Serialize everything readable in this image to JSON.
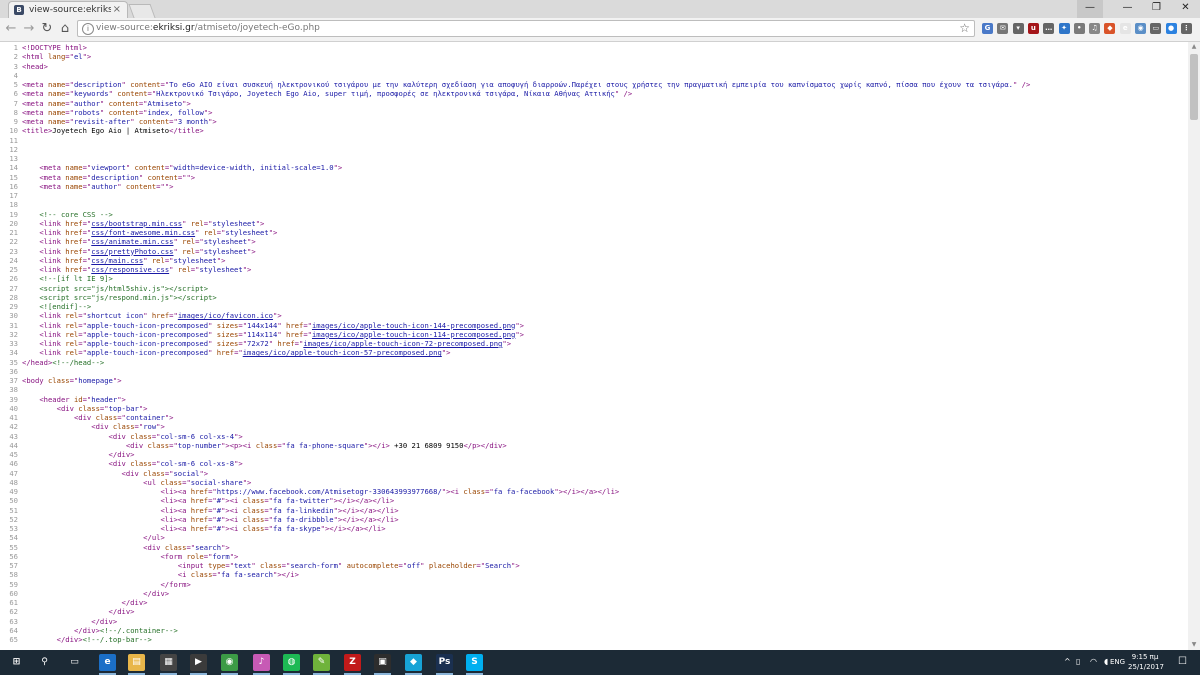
{
  "tab": {
    "favicon_letter": "B",
    "title": "view-source:ekriksi.gr/atr",
    "close": "×"
  },
  "window": {
    "user": "—",
    "minimize": "—",
    "maximize": "❐",
    "close": "✕"
  },
  "nav": {
    "back": "←",
    "forward": "→",
    "reload": "↻",
    "home": "⌂"
  },
  "omnibox": {
    "info": "i",
    "prefix": "view-source:",
    "host": "ekriksi.gr",
    "path": "/atmiseto/joyetech-eGo.php",
    "star": "☆"
  },
  "extensions": [
    {
      "name": "translate-icon",
      "color": "#4a79c8",
      "glyph": "G"
    },
    {
      "name": "mail-icon",
      "color": "#777777",
      "glyph": "✉"
    },
    {
      "name": "pocket-icon",
      "color": "#666666",
      "glyph": "▾"
    },
    {
      "name": "ublock-icon",
      "color": "#a5161a",
      "glyph": "u"
    },
    {
      "name": "lastpass-icon",
      "color": "#666666",
      "glyph": "…"
    },
    {
      "name": "puzzle-icon",
      "color": "#2f76c9",
      "glyph": "✦"
    },
    {
      "name": "ext-badge-icon",
      "color": "#7a7a7a",
      "glyph": "•"
    },
    {
      "name": "hangouts-icon",
      "color": "#888888",
      "glyph": "♫"
    },
    {
      "name": "fire-icon",
      "color": "#d9542a",
      "glyph": "◆"
    },
    {
      "name": "ebay-icon",
      "color": "#e5e5e5",
      "glyph": "e"
    },
    {
      "name": "rss-icon",
      "color": "#5b8fc7",
      "glyph": "◉"
    },
    {
      "name": "cast-icon",
      "color": "#666666",
      "glyph": "▭"
    },
    {
      "name": "chrome-apps-icon",
      "color": "#2c82e0",
      "glyph": "●"
    },
    {
      "name": "menu-icon",
      "color": "#666666",
      "glyph": "⋮"
    }
  ],
  "source_lines": [
    {
      "n": "1",
      "html": "<span class='tag'>&lt;!DOCTYPE html&gt;</span>"
    },
    {
      "n": "2",
      "html": "<span class='tag'>&lt;html <span class='attr'>lang</span>=\"<span class='val'>el</span>\"&gt;</span>"
    },
    {
      "n": "3",
      "html": "<span class='tag'>&lt;head&gt;</span>"
    },
    {
      "n": "4",
      "html": ""
    },
    {
      "n": "5",
      "html": "<span class='tag'>&lt;meta <span class='attr'>name</span>=\"<span class='val'>description</span>\" <span class='attr'>content</span>=\"<span class='val'>Το eGo AIO είναι συσκευή ηλεκτρονικού τσιγάρου με την καλύτερη σχεδίαση για αποφυγή διαρροών.Παρέχει στους χρήστες την πραγματική εμπειρία του καπνίσματος χωρίς καπνό, πίσσα που έχουν τα τσιγάρα.</span>\" /&gt;</span>"
    },
    {
      "n": "6",
      "html": "<span class='tag'>&lt;meta <span class='attr'>name</span>=\"<span class='val'>keywords</span>\" <span class='attr'>content</span>=\"<span class='val'>Ηλεκτρονικό Τσιγάρο, Joyetech Ego Aio, super τιμή, προσφορές σε ηλεκτρονικά τσιγάρα, Νίκαια Αθήνας Αττικής</span>\" /&gt;</span>"
    },
    {
      "n": "7",
      "html": "<span class='tag'>&lt;meta <span class='attr'>name</span>=\"<span class='val'>author</span>\" <span class='attr'>content</span>=\"<span class='val'>Atmiseto</span>\"&gt;</span>"
    },
    {
      "n": "8",
      "html": "<span class='tag'>&lt;meta <span class='attr'>name</span>=\"<span class='val'>robots</span>\" <span class='attr'>content</span>=\"<span class='val'>index, follow</span>\"&gt;</span>"
    },
    {
      "n": "9",
      "html": "<span class='tag'>&lt;meta <span class='attr'>name</span>=\"<span class='val'>revisit-after</span>\" <span class='attr'>content</span>=\"<span class='val'>3 month</span>\"&gt;</span>"
    },
    {
      "n": "10",
      "html": "<span class='tag'>&lt;title&gt;</span>Joyetech Ego Aio | Atmiseto<span class='tag'>&lt;/title&gt;</span>"
    },
    {
      "n": "11",
      "html": ""
    },
    {
      "n": "12",
      "html": ""
    },
    {
      "n": "13",
      "html": ""
    },
    {
      "n": "14",
      "html": "    <span class='tag'>&lt;meta <span class='attr'>name</span>=\"<span class='val'>viewport</span>\" <span class='attr'>content</span>=\"<span class='val'>width=device-width, initial-scale=1.0</span>\"&gt;</span>"
    },
    {
      "n": "15",
      "html": "    <span class='tag'>&lt;meta <span class='attr'>name</span>=\"<span class='val'>description</span>\" <span class='attr'>content</span>=\"\"&gt;</span>"
    },
    {
      "n": "16",
      "html": "    <span class='tag'>&lt;meta <span class='attr'>name</span>=\"<span class='val'>author</span>\" <span class='attr'>content</span>=\"\"&gt;</span>"
    },
    {
      "n": "17",
      "html": ""
    },
    {
      "n": "18",
      "html": ""
    },
    {
      "n": "19",
      "html": "    <span class='cmt'>&lt;!-- core CSS --&gt;</span>"
    },
    {
      "n": "20",
      "html": "    <span class='tag'>&lt;link <span class='attr'>href</span>=\"<span class='link'>css/bootstrap.min.css</span>\" <span class='attr'>rel</span>=\"<span class='val'>stylesheet</span>\"&gt;</span>"
    },
    {
      "n": "21",
      "html": "    <span class='tag'>&lt;link <span class='attr'>href</span>=\"<span class='link'>css/font-awesome.min.css</span>\" <span class='attr'>rel</span>=\"<span class='val'>stylesheet</span>\"&gt;</span>"
    },
    {
      "n": "22",
      "html": "    <span class='tag'>&lt;link <span class='attr'>href</span>=\"<span class='link'>css/animate.min.css</span>\" <span class='attr'>rel</span>=\"<span class='val'>stylesheet</span>\"&gt;</span>"
    },
    {
      "n": "23",
      "html": "    <span class='tag'>&lt;link <span class='attr'>href</span>=\"<span class='link'>css/prettyPhoto.css</span>\" <span class='attr'>rel</span>=\"<span class='val'>stylesheet</span>\"&gt;</span>"
    },
    {
      "n": "24",
      "html": "    <span class='tag'>&lt;link <span class='attr'>href</span>=\"<span class='link'>css/main.css</span>\" <span class='attr'>rel</span>=\"<span class='val'>stylesheet</span>\"&gt;</span>"
    },
    {
      "n": "25",
      "html": "    <span class='tag'>&lt;link <span class='attr'>href</span>=\"<span class='link'>css/responsive.css</span>\" <span class='attr'>rel</span>=\"<span class='val'>stylesheet</span>\"&gt;</span>"
    },
    {
      "n": "26",
      "html": "    <span class='cmt'>&lt;!--[if lt IE 9]&gt;</span>"
    },
    {
      "n": "27",
      "html": "    <span class='cmt'>&lt;script src=\"js/html5shiv.js\"&gt;&lt;/script&gt;</span>"
    },
    {
      "n": "28",
      "html": "    <span class='cmt'>&lt;script src=\"js/respond.min.js\"&gt;&lt;/script&gt;</span>"
    },
    {
      "n": "29",
      "html": "    <span class='cmt'>&lt;![endif]--&gt;</span>"
    },
    {
      "n": "30",
      "html": "    <span class='tag'>&lt;link <span class='attr'>rel</span>=\"<span class='val'>shortcut icon</span>\" <span class='attr'>href</span>=\"<span class='link'>images/ico/favicon.ico</span>\"&gt;</span>"
    },
    {
      "n": "31",
      "html": "    <span class='tag'>&lt;link <span class='attr'>rel</span>=\"<span class='val'>apple-touch-icon-precomposed</span>\" <span class='attr'>sizes</span>=\"<span class='val'>144x144</span>\" <span class='attr'>href</span>=\"<span class='link'>images/ico/apple-touch-icon-144-precomposed.png</span>\"&gt;</span>"
    },
    {
      "n": "32",
      "html": "    <span class='tag'>&lt;link <span class='attr'>rel</span>=\"<span class='val'>apple-touch-icon-precomposed</span>\" <span class='attr'>sizes</span>=\"<span class='val'>114x114</span>\" <span class='attr'>href</span>=\"<span class='link'>images/ico/apple-touch-icon-114-precomposed.png</span>\"&gt;</span>"
    },
    {
      "n": "33",
      "html": "    <span class='tag'>&lt;link <span class='attr'>rel</span>=\"<span class='val'>apple-touch-icon-precomposed</span>\" <span class='attr'>sizes</span>=\"<span class='val'>72x72</span>\" <span class='attr'>href</span>=\"<span class='link'>images/ico/apple-touch-icon-72-precomposed.png</span>\"&gt;</span>"
    },
    {
      "n": "34",
      "html": "    <span class='tag'>&lt;link <span class='attr'>rel</span>=\"<span class='val'>apple-touch-icon-precomposed</span>\" <span class='attr'>href</span>=\"<span class='link'>images/ico/apple-touch-icon-57-precomposed.png</span>\"&gt;</span>"
    },
    {
      "n": "35",
      "html": "<span class='tag'>&lt;/head&gt;</span><span class='cmt'>&lt;!--/head--&gt;</span>"
    },
    {
      "n": "36",
      "html": ""
    },
    {
      "n": "37",
      "html": "<span class='tag'>&lt;body <span class='attr'>class</span>=\"<span class='val'>homepage</span>\"&gt;</span>"
    },
    {
      "n": "38",
      "html": ""
    },
    {
      "n": "39",
      "html": "    <span class='tag'>&lt;header <span class='attr'>id</span>=\"<span class='val'>header</span>\"&gt;</span>"
    },
    {
      "n": "40",
      "html": "        <span class='tag'>&lt;div <span class='attr'>class</span>=\"<span class='val'>top-bar</span>\"&gt;</span>"
    },
    {
      "n": "41",
      "html": "            <span class='tag'>&lt;div <span class='attr'>class</span>=\"<span class='val'>container</span>\"&gt;</span>"
    },
    {
      "n": "42",
      "html": "                <span class='tag'>&lt;div <span class='attr'>class</span>=\"<span class='val'>row</span>\"&gt;</span>"
    },
    {
      "n": "43",
      "html": "                    <span class='tag'>&lt;div <span class='attr'>class</span>=\"<span class='val'>col-sm-6 col-xs-4</span>\"&gt;</span>"
    },
    {
      "n": "44",
      "html": "                        <span class='tag'>&lt;div <span class='attr'>class</span>=\"<span class='val'>top-number</span>\"&gt;&lt;p&gt;&lt;i <span class='attr'>class</span>=\"<span class='val'>fa fa-phone-square</span>\"&gt;&lt;/i&gt;</span> +30 21 6809 9150<span class='tag'>&lt;/p&gt;&lt;/div&gt;</span>"
    },
    {
      "n": "45",
      "html": "                    <span class='tag'>&lt;/div&gt;</span>"
    },
    {
      "n": "46",
      "html": "                    <span class='tag'>&lt;div <span class='attr'>class</span>=\"<span class='val'>col-sm-6 col-xs-8</span>\"&gt;</span>"
    },
    {
      "n": "47",
      "html": "                       <span class='tag'>&lt;div <span class='attr'>class</span>=\"<span class='val'>social</span>\"&gt;</span>"
    },
    {
      "n": "48",
      "html": "                            <span class='tag'>&lt;ul <span class='attr'>class</span>=\"<span class='val'>social-share</span>\"&gt;</span>"
    },
    {
      "n": "49",
      "html": "                                <span class='tag'>&lt;li&gt;&lt;a <span class='attr'>href</span>=\"<span class='val'>https://www.facebook.com/Atmisetogr-330643993977668/</span>\"&gt;&lt;i <span class='attr'>class</span>=\"<span class='val'>fa fa-facebook</span>\"&gt;&lt;/i&gt;&lt;/a&gt;&lt;/li&gt;</span>"
    },
    {
      "n": "50",
      "html": "                                <span class='tag'>&lt;li&gt;&lt;a <span class='attr'>href</span>=\"<span class='val'>#</span>\"&gt;&lt;i <span class='attr'>class</span>=\"<span class='val'>fa fa-twitter</span>\"&gt;&lt;/i&gt;&lt;/a&gt;&lt;/li&gt;</span>"
    },
    {
      "n": "51",
      "html": "                                <span class='tag'>&lt;li&gt;&lt;a <span class='attr'>href</span>=\"<span class='val'>#</span>\"&gt;&lt;i <span class='attr'>class</span>=\"<span class='val'>fa fa-linkedin</span>\"&gt;&lt;/i&gt;&lt;/a&gt;&lt;/li&gt;</span>"
    },
    {
      "n": "52",
      "html": "                                <span class='tag'>&lt;li&gt;&lt;a <span class='attr'>href</span>=\"<span class='val'>#</span>\"&gt;&lt;i <span class='attr'>class</span>=\"<span class='val'>fa fa-dribbble</span>\"&gt;&lt;/i&gt;&lt;/a&gt;&lt;/li&gt;</span>"
    },
    {
      "n": "53",
      "html": "                                <span class='tag'>&lt;li&gt;&lt;a <span class='attr'>href</span>=\"<span class='val'>#</span>\"&gt;&lt;i <span class='attr'>class</span>=\"<span class='val'>fa fa-skype</span>\"&gt;&lt;/i&gt;&lt;/a&gt;&lt;/li&gt;</span>"
    },
    {
      "n": "54",
      "html": "                            <span class='tag'>&lt;/ul&gt;</span>"
    },
    {
      "n": "55",
      "html": "                            <span class='tag'>&lt;div <span class='attr'>class</span>=\"<span class='val'>search</span>\"&gt;</span>"
    },
    {
      "n": "56",
      "html": "                                <span class='tag'>&lt;form <span class='attr'>role</span>=\"<span class='val'>form</span>\"&gt;</span>"
    },
    {
      "n": "57",
      "html": "                                    <span class='tag'>&lt;input <span class='attr'>type</span>=\"<span class='val'>text</span>\" <span class='attr'>class</span>=\"<span class='val'>search-form</span>\" <span class='attr'>autocomplete</span>=\"<span class='val'>off</span>\" <span class='attr'>placeholder</span>=\"<span class='val'>Search</span>\"&gt;</span>"
    },
    {
      "n": "58",
      "html": "                                    <span class='tag'>&lt;i <span class='attr'>class</span>=\"<span class='val'>fa fa-search</span>\"&gt;&lt;/i&gt;</span>"
    },
    {
      "n": "59",
      "html": "                                <span class='tag'>&lt;/form&gt;</span>"
    },
    {
      "n": "60",
      "html": "                            <span class='tag'>&lt;/div&gt;</span>"
    },
    {
      "n": "61",
      "html": "                       <span class='tag'>&lt;/div&gt;</span>"
    },
    {
      "n": "62",
      "html": "                    <span class='tag'>&lt;/div&gt;</span>"
    },
    {
      "n": "63",
      "html": "                <span class='tag'>&lt;/div&gt;</span>"
    },
    {
      "n": "64",
      "html": "            <span class='tag'>&lt;/div&gt;</span><span class='cmt'>&lt;!--/.container--&gt;</span>"
    },
    {
      "n": "65",
      "html": "        <span class='tag'>&lt;/div&gt;</span><span class='cmt'>&lt;!--/.top-bar--&gt;</span>"
    }
  ],
  "taskbar": {
    "apps": [
      {
        "name": "start-icon",
        "glyph": "⊞",
        "color": "transparent"
      },
      {
        "name": "search-icon",
        "glyph": "⚲",
        "color": "transparent"
      },
      {
        "name": "task-view-icon",
        "glyph": "▭",
        "color": "transparent"
      },
      {
        "name": "edge-icon",
        "glyph": "e",
        "color": "#1b6fc7"
      },
      {
        "name": "explorer-icon",
        "glyph": "▤",
        "color": "#e8b64a"
      },
      {
        "name": "store-icon",
        "glyph": "▦",
        "color": "#444444"
      },
      {
        "name": "media-icon",
        "glyph": "▶",
        "color": "#3b3b3b"
      },
      {
        "name": "chrome-icon",
        "glyph": "◉",
        "color": "#3c9b46"
      },
      {
        "name": "itunes-icon",
        "glyph": "♪",
        "color": "#c75ab5"
      },
      {
        "name": "spotify-icon",
        "glyph": "◍",
        "color": "#1db954"
      },
      {
        "name": "notepad-icon",
        "glyph": "✎",
        "color": "#6fb33b"
      },
      {
        "name": "filezilla-icon",
        "glyph": "Z",
        "color": "#c21a1a"
      },
      {
        "name": "app-icon",
        "glyph": "▣",
        "color": "#2d2d2d"
      },
      {
        "name": "kodi-icon",
        "glyph": "◆",
        "color": "#17a3d6"
      },
      {
        "name": "photoshop-icon",
        "glyph": "Ps",
        "color": "#1a3050"
      },
      {
        "name": "skype-icon",
        "glyph": "S",
        "color": "#00aff0"
      }
    ],
    "tray": {
      "chevron": "^",
      "lang": "ENG",
      "time": "9:15 πμ",
      "date": "25/1/2017",
      "notif": "☐"
    }
  }
}
